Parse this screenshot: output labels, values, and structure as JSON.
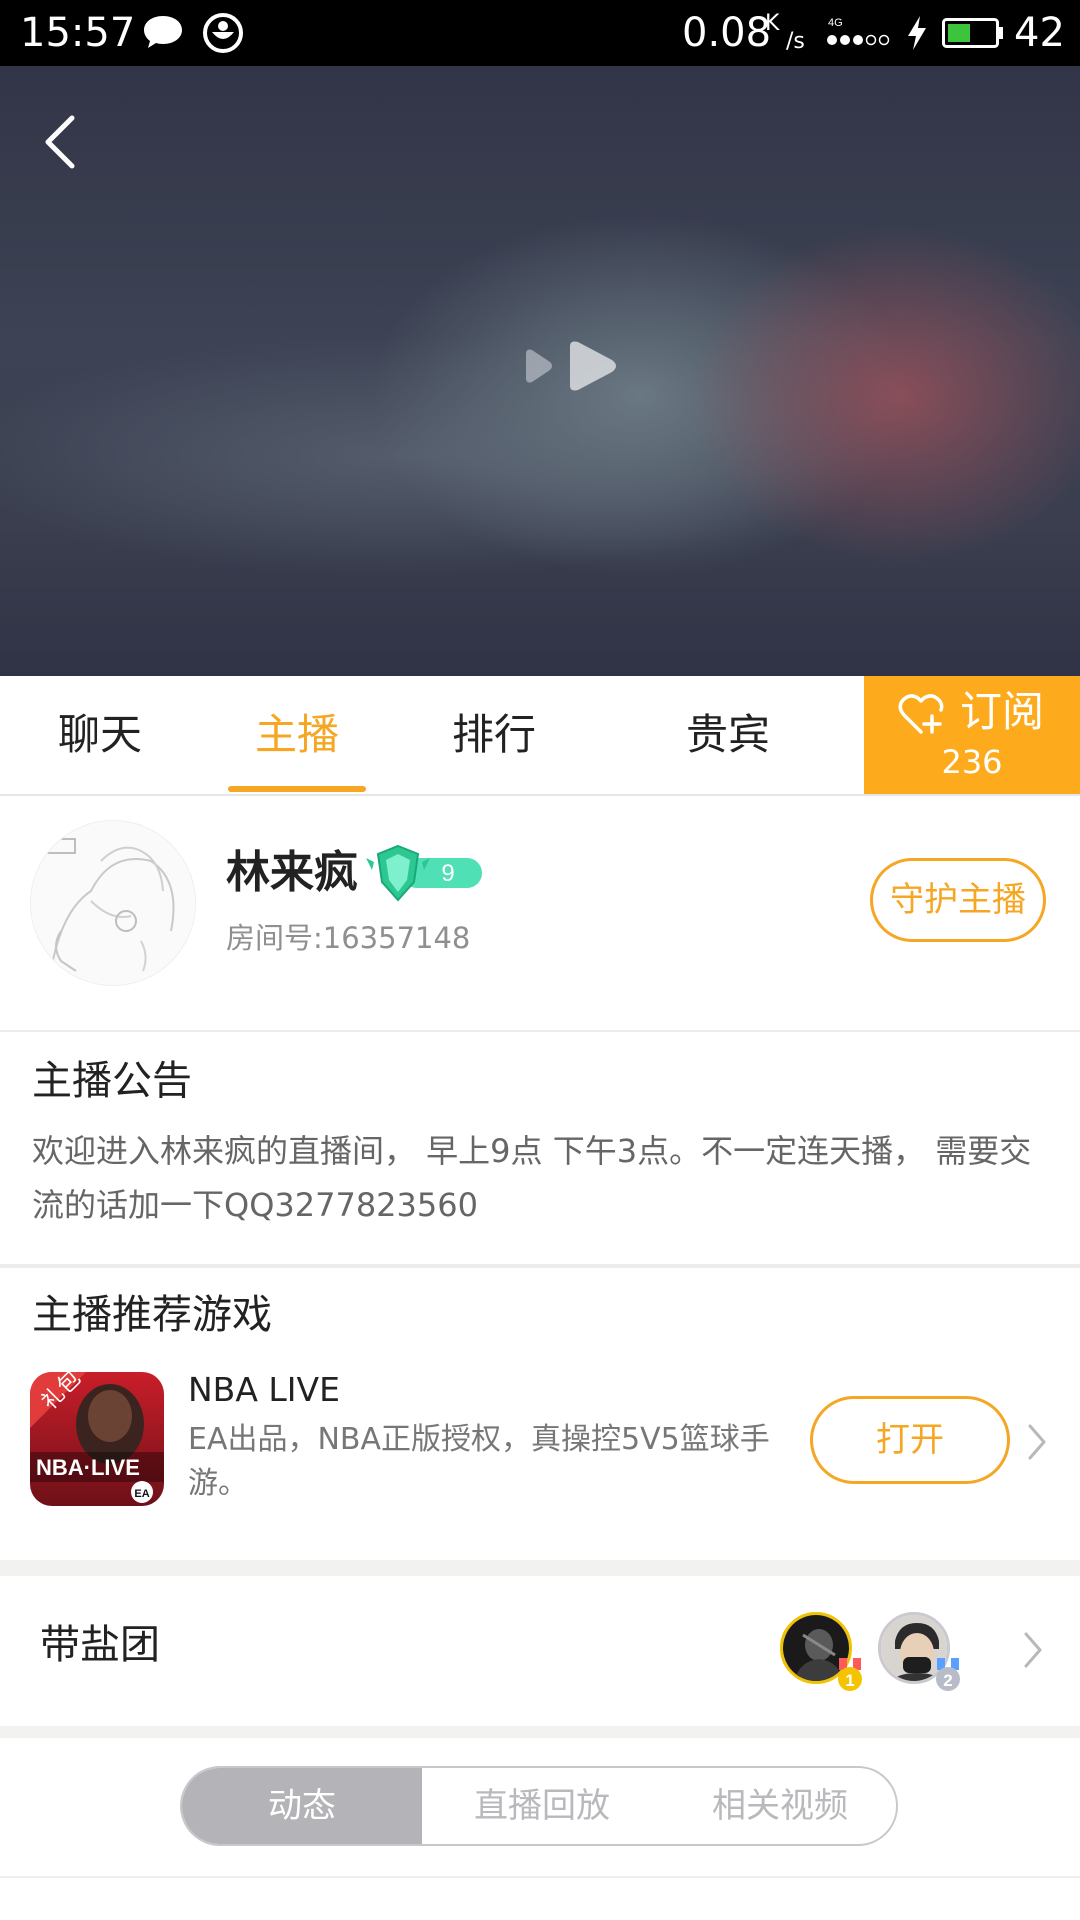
{
  "status_bar": {
    "time": "15:57",
    "net_speed": "0.08",
    "net_unit_top": "K",
    "net_unit_bottom": "/s",
    "battery_level": "42",
    "icons": [
      "chat-bubble-icon",
      "app-circle-icon",
      "signal-4g-icon",
      "charging-bolt-icon",
      "battery-icon"
    ]
  },
  "video": {
    "back_icon": "chevron-left-icon",
    "play_icon": "play-icon"
  },
  "tabs": {
    "items": [
      {
        "label": "聊天",
        "active": false
      },
      {
        "label": "主播",
        "active": true
      },
      {
        "label": "排行",
        "active": false
      },
      {
        "label": "贵宾",
        "active": false
      }
    ],
    "subscribe_label": "订阅",
    "subscribe_count": "236",
    "accent": "#f5a623"
  },
  "anchor": {
    "name": "林来疯",
    "level": "9",
    "room_id": "房间号:16357148",
    "guard_label": "守护主播"
  },
  "announcement": {
    "title": "主播公告",
    "text": "欢迎进入林来疯的直播间， 早上9点  下午3点。不一定连天播， 需要交流的话加一下QQ3277823560"
  },
  "game": {
    "section_title": "主播推荐游戏",
    "name": "NBA LIVE",
    "description": "EA出品，NBA正版授权，真操控5V5篮球手游。",
    "icon_tag": "礼包",
    "icon_title": "NBA·LIVE",
    "open_label": "打开"
  },
  "salt_group": {
    "title": "带盐团",
    "ranks": [
      "1",
      "2"
    ]
  },
  "segments": {
    "items": [
      {
        "label": "动态",
        "active": true
      },
      {
        "label": "直播回放",
        "active": false
      },
      {
        "label": "相关视频",
        "active": false
      }
    ]
  }
}
